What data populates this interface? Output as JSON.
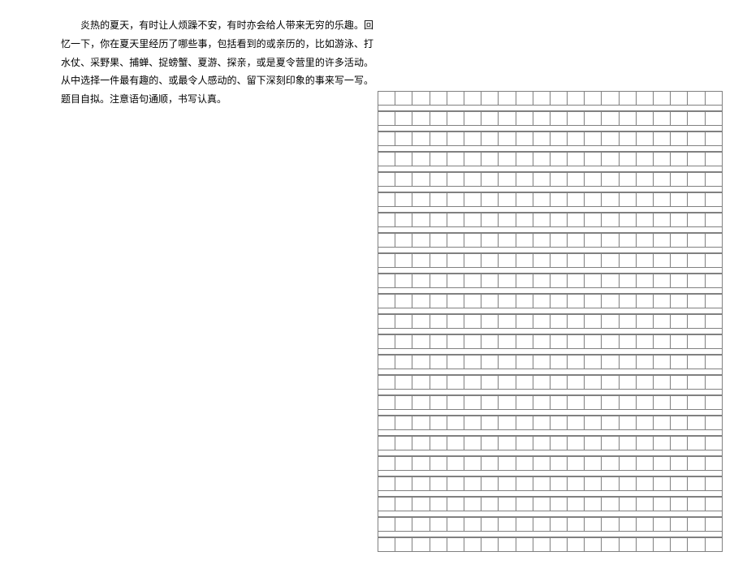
{
  "prompt": {
    "text": "炎热的夏天，有时让人烦躁不安，有时亦会给人带来无穷的乐趣。回忆一下，你在夏天里经历了哪些事，包括看到的或亲历的，比如游泳、打水仗、采野果、捕蝉、捉螃蟹、夏游、探亲，或是夏令营里的许多活动。从中选择一件最有趣的、或最令人感动的、留下深刻印象的事来写一写。题目自拟。注意语句通顺，书写认真。"
  },
  "grid": {
    "rows": 23,
    "cols": 20
  }
}
